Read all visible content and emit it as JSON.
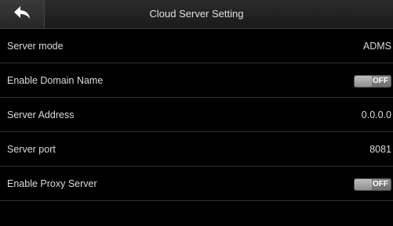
{
  "header": {
    "title": "Cloud Server Setting",
    "back_icon": "back-arrow-icon"
  },
  "rows": [
    {
      "label": "Server mode",
      "value": "ADMS"
    },
    {
      "label": "Enable Domain Name",
      "toggle": "OFF"
    },
    {
      "label": "Server Address",
      "value": "0.0.0.0"
    },
    {
      "label": "Server port",
      "value": "8081"
    },
    {
      "label": "Enable Proxy Server",
      "toggle": "OFF"
    }
  ]
}
